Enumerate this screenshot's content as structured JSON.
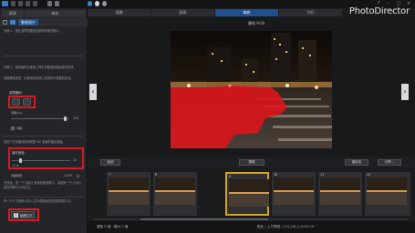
{
  "titlebar": {
    "brand": "PhotoDirector"
  },
  "tabs": [
    "媒體",
    "圖庫",
    "編修",
    "列印"
  ],
  "active_tab_index": 2,
  "left_panel": {
    "tabs": [
      "圖庫",
      "編修"
    ],
    "header_title": "動態照片",
    "intro_text": "步驟 1：按此選擇您要套用動態效果的照片。",
    "step2_text": "步驟 2：使用筆刷在畫面上標示您要讓其動起來的區域。",
    "step2_hint": "若要移除遮罩，請使用橡皮擦工具擦除不需要的區域。",
    "brush_label": "遮罩筆刷",
    "brush_size_label": "筆刷大小：",
    "brush_size_value": "200",
    "clear_label": "清除",
    "step3_text": "請按下方的播放按鈕預覽 GIF 動畫的播放速度。",
    "speed_label": "播放速度：",
    "speed_min": "0.1x",
    "speed_max": "10",
    "duration_label": "持續時間",
    "duration_value": "5.000",
    "duration_unit": "秒",
    "step4_text": "完成後，按一下 [儲存] 來儲存動態照片，或是按一下 [分享] 將您的照片分享出去。",
    "step5_text": "按一下以下按鈕以加入文字或圖像到您的動態照片中。",
    "text_button_label": "編輯文字",
    "accent_color": "#1f4f8e",
    "highlight_color": "#d81a22"
  },
  "viewer": {
    "counter": "畫格 9/30",
    "prev_icon": "chevron-left-icon",
    "next_icon": "chevron-right-icon"
  },
  "controls": {
    "back_label": "返回",
    "preview_label": "預覽",
    "save_label": "儲存至",
    "share_label": "分享..."
  },
  "filmstrip": {
    "frames": [
      "7",
      "8",
      "9",
      "10",
      "11",
      "12"
    ],
    "selected_frame": "9"
  },
  "statusbar": {
    "left_text": "選取 0 個 - 顯示 0 個",
    "center_text": "點此 / 上方預覽 / 101_HD_2-0001.tif"
  }
}
